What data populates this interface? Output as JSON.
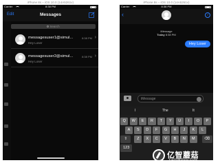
{
  "left_window": {
    "sim_title": "iPhone 8s – iOS 10.0 (14A5261v)",
    "status": {
      "carrier": "Carrier",
      "time": "8:38 PM"
    },
    "nav": {
      "edit_label": "Edit",
      "title": "Messages",
      "compose_icon": "compose-icon"
    },
    "search": {
      "placeholder": "Search"
    },
    "conversations": [
      {
        "name": "messagesuser1@simul...",
        "time": "8:38 PM",
        "preview": "Hey Loser"
      },
      {
        "name": "messagesuser2@simul...",
        "time": "8:38 PM",
        "preview": "Hey Loser"
      }
    ]
  },
  "right_window": {
    "sim_title": "iPhone 8s – iOS 10.0 (14A5261v)",
    "status": {
      "carrier": "Carrier",
      "time": "8:38 PM"
    },
    "header": {
      "back_icon": "chevron-left-icon",
      "info_icon": "info-icon"
    },
    "meta": {
      "service": "iMessage",
      "day": "Today",
      "time": "8:38 PM"
    },
    "bubble_text": "Hey Loser",
    "input": {
      "placeholder": "iMessage"
    },
    "suggestions": [
      "I",
      "The",
      "It"
    ],
    "keyboard": {
      "row1": [
        "Q",
        "W",
        "E",
        "R",
        "T",
        "Y",
        "U",
        "I",
        "O",
        "P"
      ],
      "row2": [
        "A",
        "S",
        "D",
        "F",
        "G",
        "H",
        "J",
        "K",
        "L"
      ],
      "row3": [
        "Z",
        "X",
        "C",
        "V",
        "B",
        "N",
        "M"
      ],
      "shift_glyph": "⇧",
      "delete_glyph": "⌫",
      "numbers_label": "123"
    }
  },
  "watermark": {
    "brand": "亿智蘑菇",
    "url": "YIZHIMOGU.COM"
  }
}
